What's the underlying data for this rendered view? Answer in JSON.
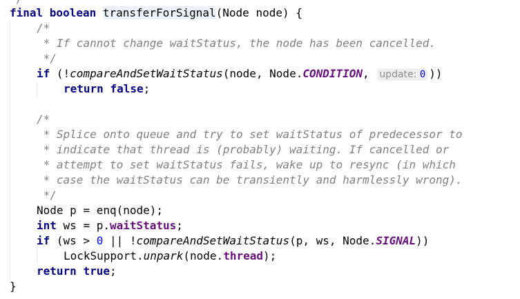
{
  "code": {
    "top_fragment": "*/",
    "l1": {
      "kw": "final boolean",
      "method": "transferForSignal",
      "rest": "(Node node) {"
    },
    "c1_open": "/*",
    "c1_text": "* If cannot change waitStatus, the node has been cancelled.",
    "c1_close": "*/",
    "if1": {
      "kw": "if",
      "p1": " (!",
      "call": "compareAndSetWaitStatus",
      "p2": "(node, Node.",
      "const": "CONDITION",
      "p3": ",",
      "hint_label": "update:",
      "hint_value": "0",
      "p4": "))"
    },
    "ret_false": {
      "kw": "return",
      "val": "false",
      "end": ";"
    },
    "c2_open": "/*",
    "c2_l1": "* Splice onto queue and try to set waitStatus of predecessor to",
    "c2_l2": "* indicate that thread is (probably) waiting. If cancelled or",
    "c2_l3": "* attempt to set waitStatus fails, wake up to resync (in which",
    "c2_l4": "* case the waitStatus can be transiently and harmlessly wrong).",
    "c2_close": "*/",
    "node_p": "Node p = enq(node);",
    "int_ws": {
      "kw": "int",
      "p1": " ws = p.",
      "field": "waitStatus",
      "end": ";"
    },
    "if2": {
      "kw": "if",
      "p1": " (ws > ",
      "num": "0",
      "p2": " || !",
      "call": "compareAndSetWaitStatus",
      "p3": "(p, ws, Node.",
      "const": "SIGNAL",
      "p4": "))"
    },
    "unpark": {
      "cls": "LockSupport.",
      "call": "unpark",
      "p1": "(node.",
      "field": "thread",
      "end": ");"
    },
    "ret_true": {
      "kw": "return",
      "val": "true",
      "end": ";"
    },
    "close_brace": "}"
  },
  "colors": {
    "keyword": "#000080",
    "comment": "#808080",
    "field": "#660e7a",
    "number": "#0000ff",
    "hint_bg": "#efefef"
  }
}
